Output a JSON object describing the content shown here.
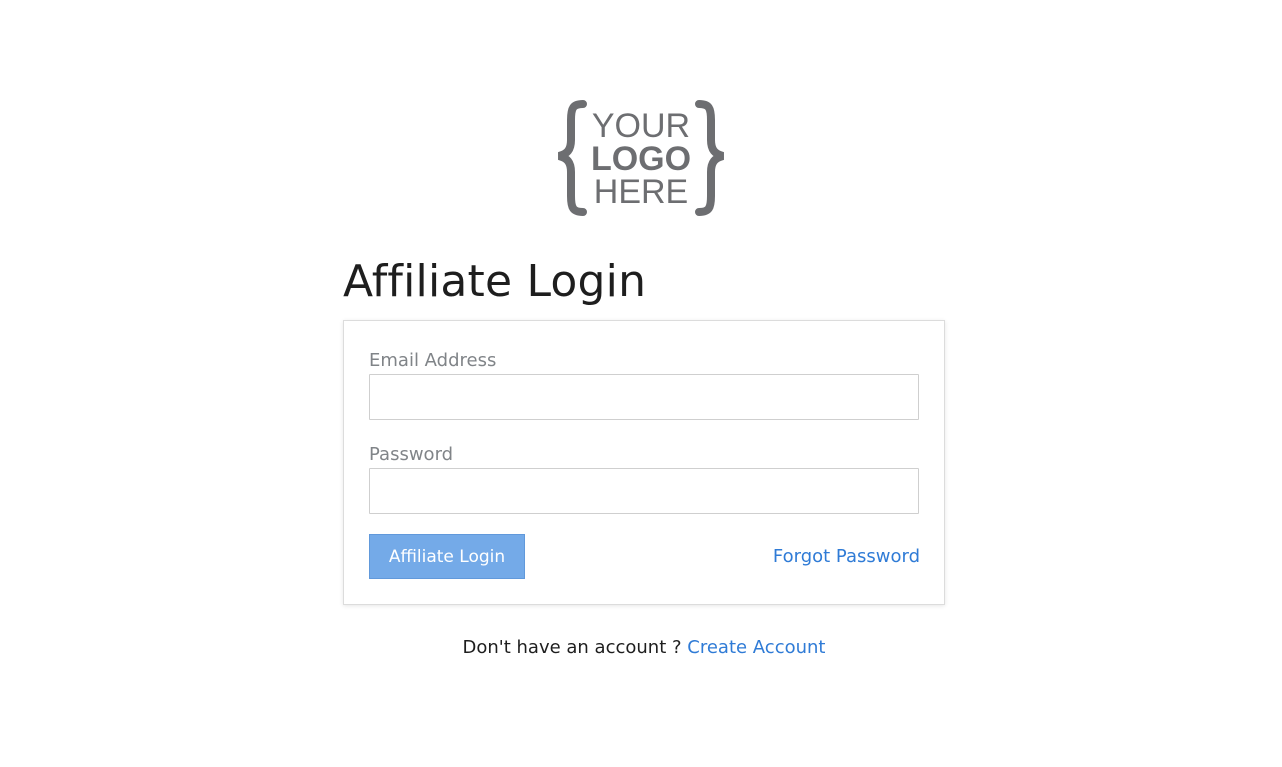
{
  "logo": {
    "line1": "YOUR",
    "line2": "LOGO",
    "line3": "HERE",
    "color": "#6d6e71"
  },
  "page": {
    "title": "Affiliate Login"
  },
  "form": {
    "email_label": "Email Address",
    "email_value": "",
    "password_label": "Password",
    "password_value": "",
    "submit_label": "Affiliate Login",
    "forgot_label": "Forgot Password"
  },
  "signup": {
    "prompt": "Don't have an account ?",
    "link_label": "Create Account"
  },
  "colors": {
    "accent": "#2f7bd6",
    "button": "#74aae8",
    "label": "#808488"
  }
}
